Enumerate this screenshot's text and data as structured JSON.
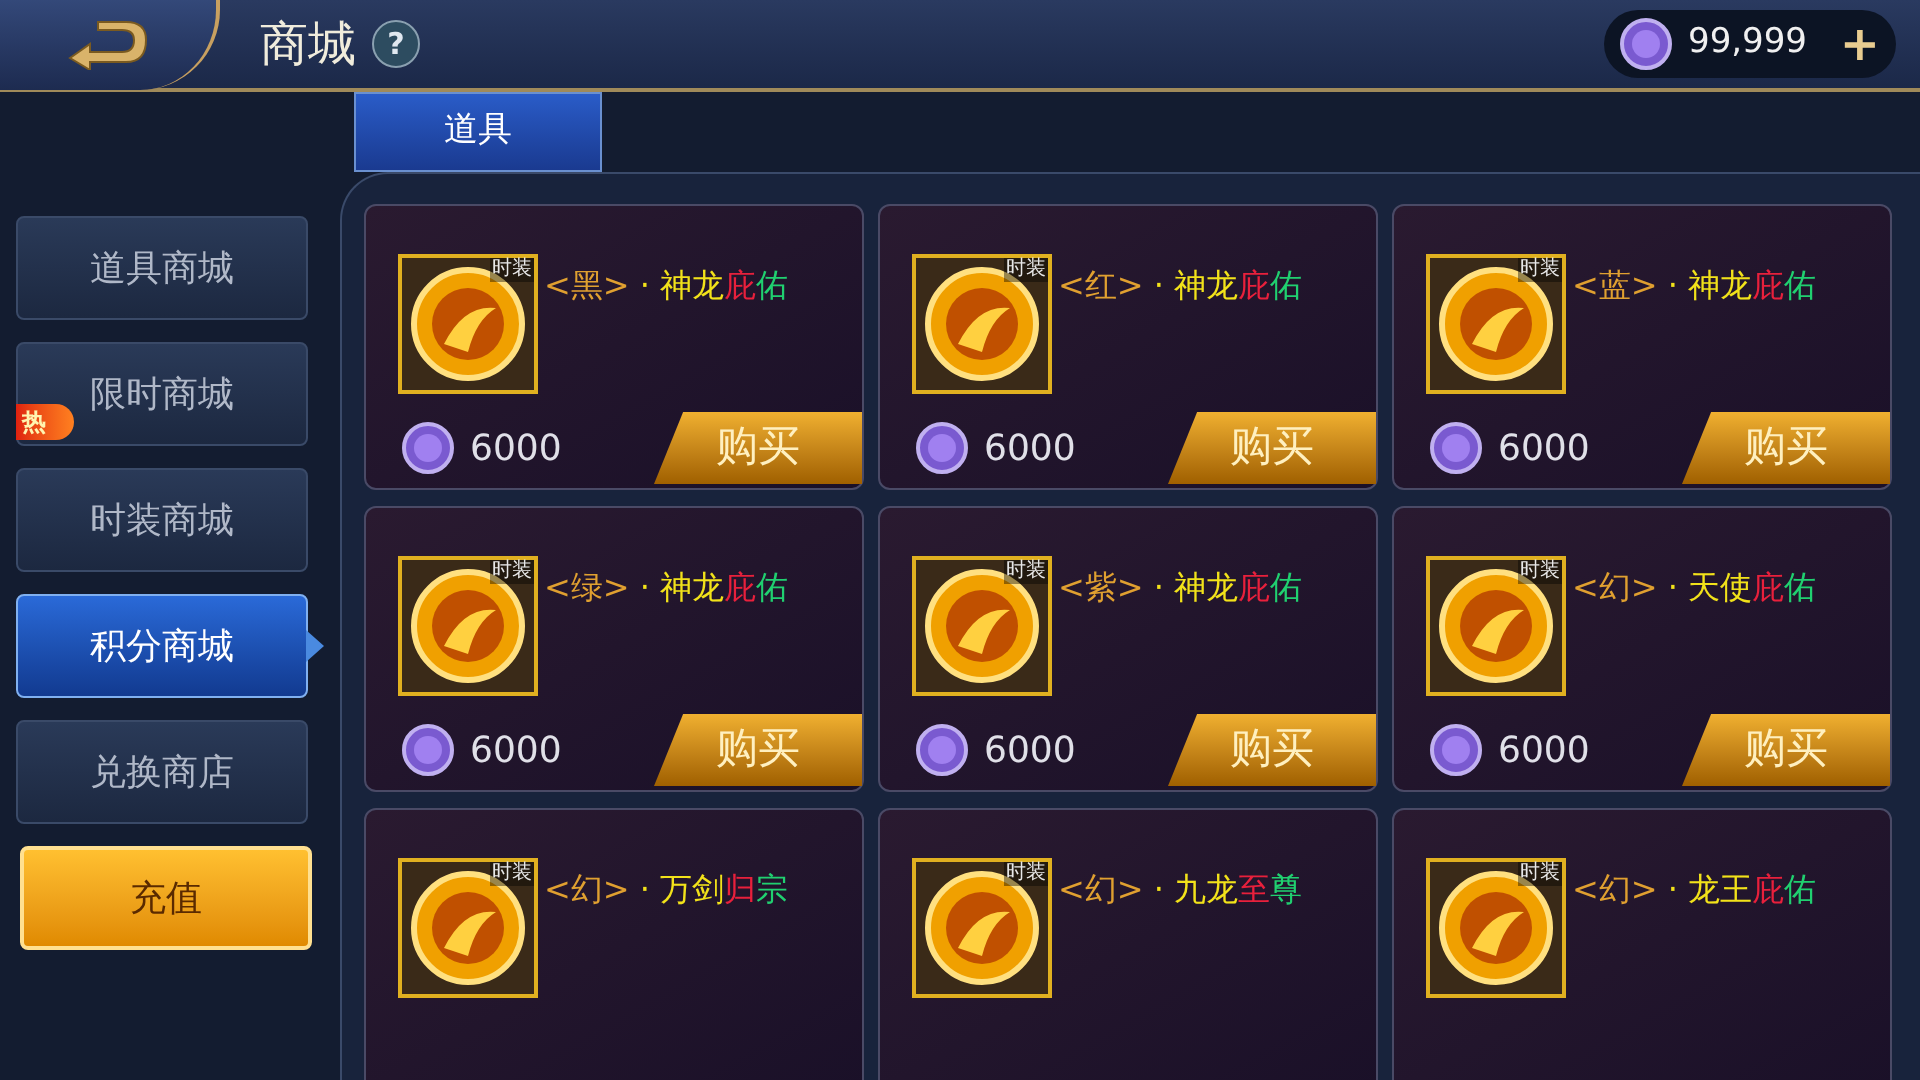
{
  "header": {
    "title": "商城",
    "help": "?",
    "currency": "99,999",
    "add": "+"
  },
  "tabs": [
    {
      "label": "道具",
      "selected": true
    }
  ],
  "sidebar": [
    {
      "label": "道具商城",
      "selected": false,
      "kind": "nav"
    },
    {
      "label": "限时商城",
      "selected": false,
      "kind": "nav",
      "badge": "热"
    },
    {
      "label": "时装商城",
      "selected": false,
      "kind": "nav"
    },
    {
      "label": "积分商城",
      "selected": true,
      "kind": "nav"
    },
    {
      "label": "兑换商店",
      "selected": false,
      "kind": "nav"
    },
    {
      "label": "充值",
      "selected": false,
      "kind": "recharge"
    }
  ],
  "items": [
    {
      "tag": "时装",
      "name": [
        {
          "text": "<黑>",
          "color": "#e0a030"
        },
        {
          "text": " · 神龙",
          "color": "#f2e21a"
        },
        {
          "text": "庇",
          "color": "#e8203c"
        },
        {
          "text": "佑",
          "color": "#20d070"
        }
      ],
      "price": "6000",
      "buy": "购买"
    },
    {
      "tag": "时装",
      "name": [
        {
          "text": "<红>",
          "color": "#e0a030"
        },
        {
          "text": " · 神龙",
          "color": "#f2e21a"
        },
        {
          "text": "庇",
          "color": "#e8203c"
        },
        {
          "text": "佑",
          "color": "#20d070"
        }
      ],
      "price": "6000",
      "buy": "购买"
    },
    {
      "tag": "时装",
      "name": [
        {
          "text": "<蓝>",
          "color": "#e0a030"
        },
        {
          "text": " · 神龙",
          "color": "#f2e21a"
        },
        {
          "text": "庇",
          "color": "#e8203c"
        },
        {
          "text": "佑",
          "color": "#20d070"
        }
      ],
      "price": "6000",
      "buy": "购买"
    },
    {
      "tag": "时装",
      "name": [
        {
          "text": "<绿>",
          "color": "#e0a030"
        },
        {
          "text": " · 神龙",
          "color": "#f2e21a"
        },
        {
          "text": "庇",
          "color": "#e8203c"
        },
        {
          "text": "佑",
          "color": "#20d070"
        }
      ],
      "price": "6000",
      "buy": "购买"
    },
    {
      "tag": "时装",
      "name": [
        {
          "text": "<紫>",
          "color": "#e0a030"
        },
        {
          "text": " · 神龙",
          "color": "#f2e21a"
        },
        {
          "text": "庇",
          "color": "#e8203c"
        },
        {
          "text": "佑",
          "color": "#20d070"
        }
      ],
      "price": "6000",
      "buy": "购买"
    },
    {
      "tag": "时装",
      "name": [
        {
          "text": "<幻>",
          "color": "#e0a030"
        },
        {
          "text": " · 天使",
          "color": "#f2e21a"
        },
        {
          "text": "庇",
          "color": "#e8203c"
        },
        {
          "text": "佑",
          "color": "#20d070"
        }
      ],
      "price": "6000",
      "buy": "购买"
    },
    {
      "tag": "时装",
      "name": [
        {
          "text": "<幻>",
          "color": "#e0a030"
        },
        {
          "text": " · 万剑",
          "color": "#f2e21a"
        },
        {
          "text": "归",
          "color": "#e8203c"
        },
        {
          "text": "宗",
          "color": "#20d070"
        }
      ]
    },
    {
      "tag": "时装",
      "name": [
        {
          "text": "<幻>",
          "color": "#e0a030"
        },
        {
          "text": " · 九龙",
          "color": "#f2e21a"
        },
        {
          "text": "至",
          "color": "#e8203c"
        },
        {
          "text": "尊",
          "color": "#20d070"
        }
      ]
    },
    {
      "tag": "时装",
      "name": [
        {
          "text": "<幻>",
          "color": "#e0a030"
        },
        {
          "text": " · 龙王",
          "color": "#f2e21a"
        },
        {
          "text": "庇",
          "color": "#e8203c"
        },
        {
          "text": "佑",
          "color": "#20d070"
        }
      ]
    }
  ]
}
